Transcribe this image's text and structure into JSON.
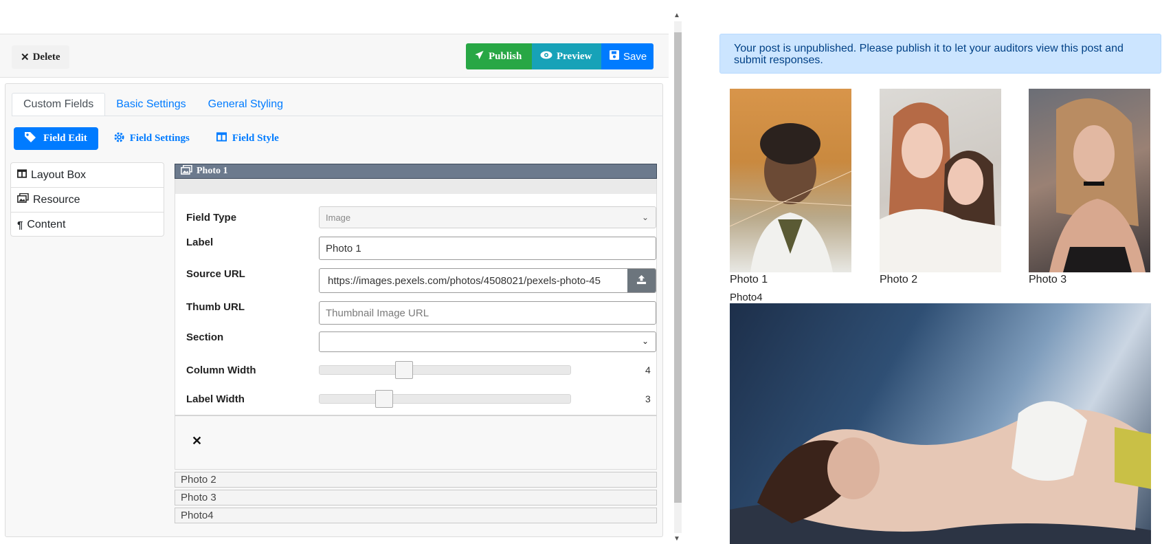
{
  "toolbar": {
    "delete_label": "Delete",
    "publish_label": "Publish",
    "preview_label": "Preview",
    "save_label": "Save"
  },
  "tabs": [
    "Custom Fields",
    "Basic Settings",
    "General Styling"
  ],
  "subnav": [
    "Field Edit",
    "Field Settings",
    "Field Style"
  ],
  "sidebar": [
    "Layout Box",
    "Resource",
    "Content"
  ],
  "field_panel": {
    "title": "Photo 1",
    "field_type": {
      "label": "Field Type",
      "value": "Image"
    },
    "label": {
      "label": "Label",
      "value": "Photo 1"
    },
    "source_url": {
      "label": "Source URL",
      "value": "https://images.pexels.com/photos/4508021/pexels-photo-45"
    },
    "thumb_url": {
      "label": "Thumb URL",
      "placeholder": "Thumbnail Image URL"
    },
    "section": {
      "label": "Section",
      "value": ""
    },
    "column_width": {
      "label": "Column Width",
      "value": "4",
      "fraction": 0.33
    },
    "label_width": {
      "label": "Label Width",
      "value": "3",
      "fraction": 0.25
    }
  },
  "collapsed_fields": [
    "Photo 2",
    "Photo 3",
    "Photo4"
  ],
  "preview": {
    "alert": "Your post is unpublished. Please publish it to let your auditors view this post and submit responses.",
    "captions": [
      "Photo 1",
      "Photo 2",
      "Photo 3"
    ],
    "photo4_caption": "Photo4"
  }
}
